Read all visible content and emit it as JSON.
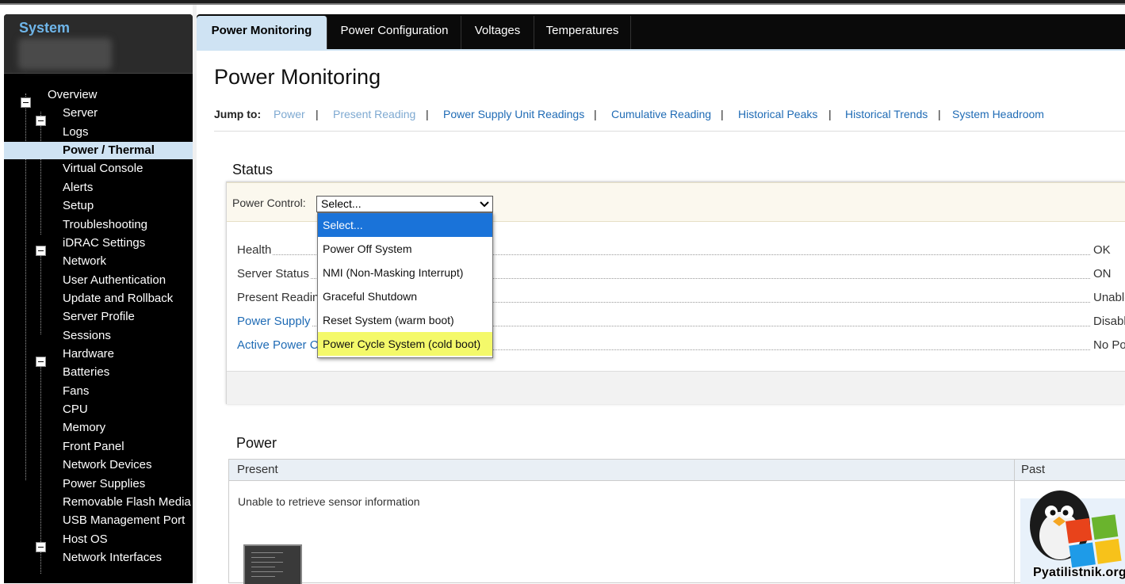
{
  "sidebar": {
    "title": "System",
    "tree": [
      {
        "label": "Overview"
      },
      {
        "label": "Server"
      },
      {
        "label": "Logs"
      },
      {
        "label": "Power / Thermal"
      },
      {
        "label": "Virtual Console"
      },
      {
        "label": "Alerts"
      },
      {
        "label": "Setup"
      },
      {
        "label": "Troubleshooting"
      },
      {
        "label": "iDRAC Settings"
      },
      {
        "label": "Network"
      },
      {
        "label": "User Authentication"
      },
      {
        "label": "Update and Rollback"
      },
      {
        "label": "Server Profile"
      },
      {
        "label": "Sessions"
      },
      {
        "label": "Hardware"
      },
      {
        "label": "Batteries"
      },
      {
        "label": "Fans"
      },
      {
        "label": "CPU"
      },
      {
        "label": "Memory"
      },
      {
        "label": "Front Panel"
      },
      {
        "label": "Network Devices"
      },
      {
        "label": "Power Supplies"
      },
      {
        "label": "Removable Flash Media"
      },
      {
        "label": "USB Management Port"
      },
      {
        "label": "Host OS"
      },
      {
        "label": "Network Interfaces"
      }
    ]
  },
  "tabs": [
    "Power Monitoring",
    "Power Configuration",
    "Voltages",
    "Temperatures"
  ],
  "page": {
    "title": "Power Monitoring",
    "jump_label": "Jump to:",
    "jump_links": [
      "Power",
      "Present Reading",
      "Power Supply Unit Readings",
      "Cumulative Reading",
      "Historical Peaks",
      "Historical Trends",
      "System Headroom"
    ],
    "jump_separator": "|"
  },
  "status": {
    "title": "Status",
    "power_control_label": "Power Control:",
    "selected": "Select...",
    "chevron": "⌄",
    "options": [
      "Select...",
      "Power Off System",
      "NMI (Non-Masking Interrupt)",
      "Graceful Shutdown",
      "Reset System (warm boot)",
      "Power Cycle System (cold boot)"
    ],
    "rows": [
      {
        "key": "Health",
        "value": "OK"
      },
      {
        "key": "Server Status",
        "value": "ON"
      },
      {
        "key": "Present Reading",
        "value": "Unable"
      },
      {
        "key": "Power Supply",
        "value": "Disable"
      },
      {
        "key": "Active Power C",
        "value": "No Po"
      }
    ]
  },
  "power": {
    "title": "Power",
    "present_header": "Present",
    "past_header": "Past",
    "message": "Unable to retrieve sensor information"
  },
  "watermark": {
    "text": "Pyatilistnik.org"
  },
  "colors": {
    "link": "#1f6bb5",
    "selected_nav": "#cfe3f3",
    "option_selected": "#1a73d9",
    "option_highlight": "#f4f96a",
    "sidebar_title": "#6fb6ea"
  }
}
